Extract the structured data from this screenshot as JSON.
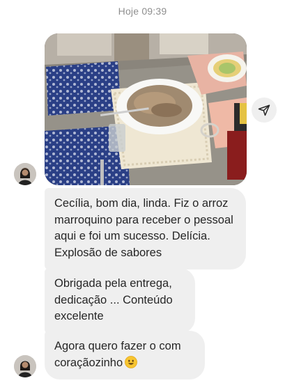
{
  "chat": {
    "timestamp": "Hoje 09:39",
    "messages": [
      {
        "type": "image",
        "description_icon": "photo"
      },
      {
        "type": "text",
        "text": "Cecília, bom dia, linda. Fiz o arroz marroquino para receber o pessoal aqui e foi um sucesso. Delícia. Explosão de sabores"
      },
      {
        "type": "text",
        "text": "Obrigada pela entrega, dedicação ... Conteúdo excelente"
      },
      {
        "type": "text",
        "text": "Agora quero fazer o com coraçãozinho"
      }
    ],
    "icons": {
      "share": "paper-plane-icon",
      "emoji": "smiling-face-icon"
    }
  },
  "colors": {
    "bubble_bg": "#efefef",
    "text": "#262626",
    "timestamp": "#8e8e8e"
  }
}
